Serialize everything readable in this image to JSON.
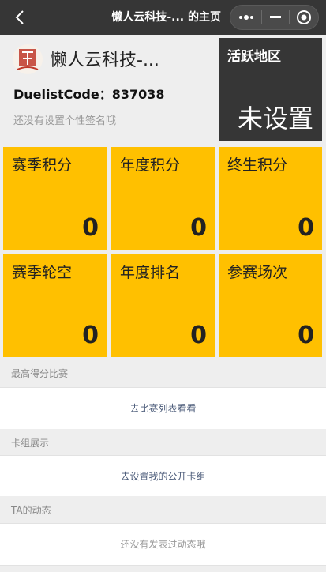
{
  "navbar": {
    "title": "懒人云科技-... 的主页",
    "back_icon": "chevron-left-icon",
    "more_icon": "more-dots-icon",
    "minimize_icon": "minimize-icon",
    "close_icon": "target-circle-icon"
  },
  "profile": {
    "nickname": "懒人云科技-...",
    "duelist_label": "DuelistCode：837038",
    "signature": "还没有设置个性签名哦",
    "avatar_icon": "brand-logo-avatar"
  },
  "region": {
    "label": "活跃地区",
    "value": "未设置"
  },
  "stats": [
    {
      "label": "赛季积分",
      "value": "0"
    },
    {
      "label": "年度积分",
      "value": "0"
    },
    {
      "label": "终生积分",
      "value": "0"
    },
    {
      "label": "赛季轮空",
      "value": "0"
    },
    {
      "label": "年度排名",
      "value": "0"
    },
    {
      "label": "参赛场次",
      "value": "0"
    }
  ],
  "sections": {
    "best_match": {
      "title": "最高得分比赛",
      "content": "去比赛列表看看"
    },
    "deck_display": {
      "title": "卡组展示",
      "content": "去设置我的公开卡组"
    },
    "activity": {
      "title": "TA的动态",
      "content": "还没有发表过动态哦"
    }
  },
  "colors": {
    "navbar": "#363636",
    "tile": "#ffc000",
    "region": "#363636",
    "link": "#4a5a78"
  }
}
